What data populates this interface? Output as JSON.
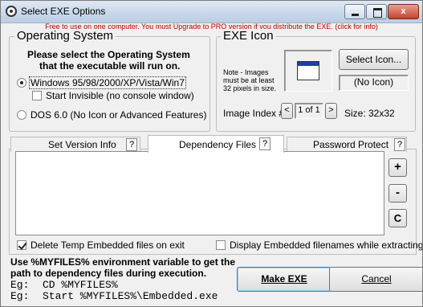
{
  "window": {
    "title": "Select EXE Options",
    "notice": "Free to use on one computer. You must Upgrade to PRO version if you distribute the EXE. (click for info)",
    "close_glyph": "x"
  },
  "os_group": {
    "title": "Operating System",
    "instruction_line1": "Please select the Operating System",
    "instruction_line2": "that the executable will run on.",
    "option_windows": "Windows 95/98/2000/XP/Vista/Win7",
    "start_invisible": "Start Invisible (no console window)",
    "option_dos": "DOS 6.0  (No Icon or Advanced Features)",
    "selected": "windows"
  },
  "icon_group": {
    "title": "EXE Icon",
    "note": "Note - Images must be at least 32 pixels in size.",
    "select_button": "Select Icon...",
    "current_icon": "(No Icon)",
    "image_index_label": "Image Index #",
    "index_value": "1 of 1",
    "prev_glyph": "<",
    "next_glyph": ">",
    "size_label": "Size: 32x32"
  },
  "tabs": [
    {
      "label": "Set Version Info",
      "help": "?"
    },
    {
      "label": "Dependency Files",
      "help": "?"
    },
    {
      "label": "Password Protect",
      "help": "?"
    }
  ],
  "active_tab": "Dependency Files",
  "side_buttons": {
    "add": "+",
    "remove": "-",
    "clear": "C"
  },
  "options": {
    "delete_temp": {
      "label": "Delete Temp Embedded files on exit",
      "checked": true
    },
    "display_names": {
      "label": "Display Embedded filenames while extracting",
      "checked": false
    }
  },
  "help_text": {
    "line1": "Use %MYFILES% environment variable to get the",
    "line2": "path to dependency files during execution.",
    "example1_prefix": "Eg:",
    "example1": "CD %MYFILES%",
    "example2_prefix": "Eg:",
    "example2": "Start %MYFILES%\\Embedded.exe"
  },
  "footer_buttons": {
    "ok": "Make EXE",
    "cancel": "Cancel"
  }
}
